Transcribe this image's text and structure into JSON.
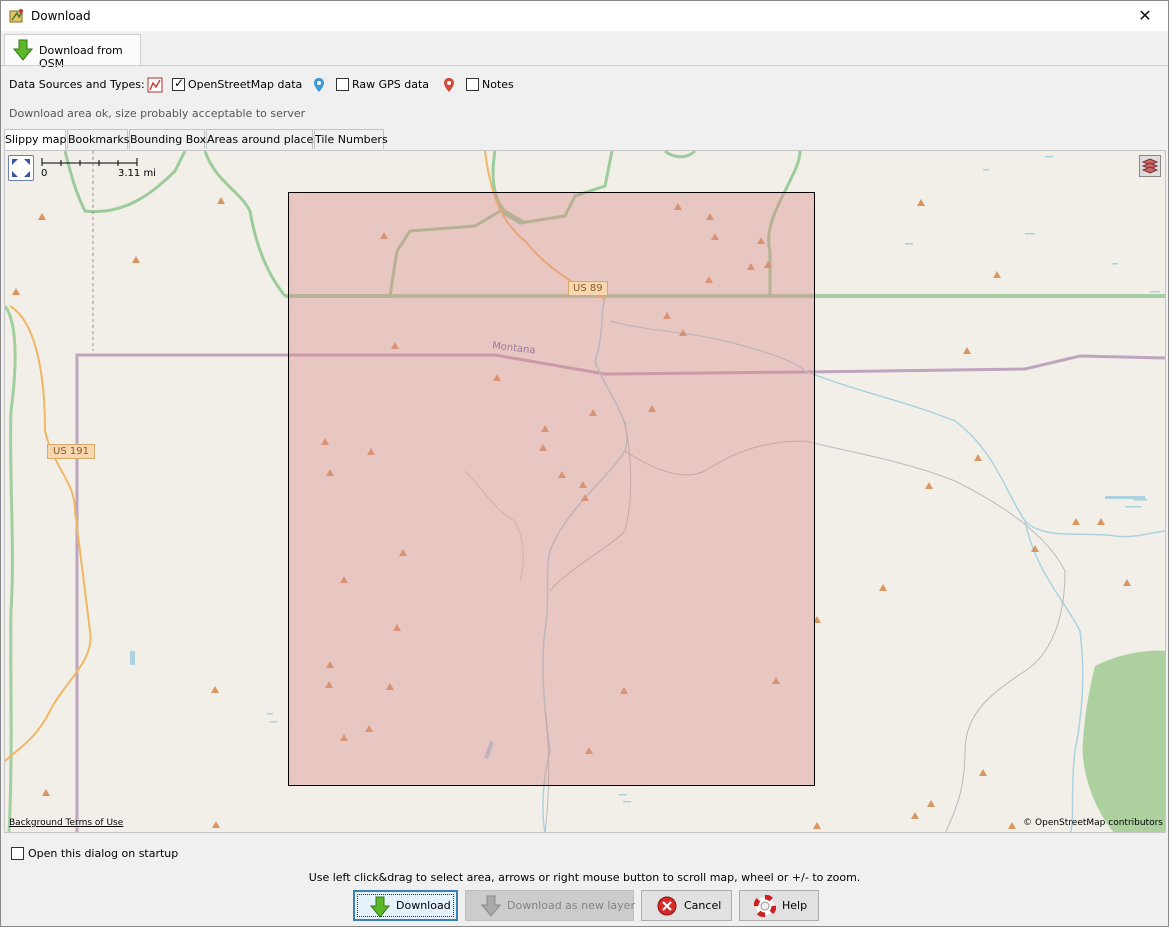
{
  "window": {
    "title": "Download",
    "close_symbol": "✕"
  },
  "main_tab": {
    "label": "Download from OSM"
  },
  "sources": {
    "label": "Data Sources and Types:",
    "items": [
      {
        "label": "OpenStreetMap data",
        "checked": true
      },
      {
        "label": "Raw GPS data",
        "checked": false
      },
      {
        "label": "Notes",
        "checked": false
      }
    ]
  },
  "status_text": "Download area ok, size probably acceptable to server",
  "tabs": [
    "Slippy map",
    "Bookmarks",
    "Bounding Box",
    "Areas around places",
    "Tile Numbers"
  ],
  "active_tab": "Slippy map",
  "map": {
    "scale_start": "0",
    "scale_end": "3.11 mi",
    "labels": {
      "road_us89": "US 89",
      "road_us191": "US 191",
      "state": "Montana"
    },
    "background_terms": "Background Terms of Use",
    "credit": "© OpenStreetMap contributors",
    "selection_color": "#e8a6a6"
  },
  "options": {
    "open_on_startup_label": "Open this dialog on startup",
    "open_on_startup_checked": false
  },
  "hint": "Use left click&drag to select area, arrows or right mouse button to scroll map, wheel or +/- to zoom.",
  "buttons": {
    "download": "Download",
    "download_new_layer": "Download as new layer",
    "cancel": "Cancel",
    "help": "Help"
  }
}
